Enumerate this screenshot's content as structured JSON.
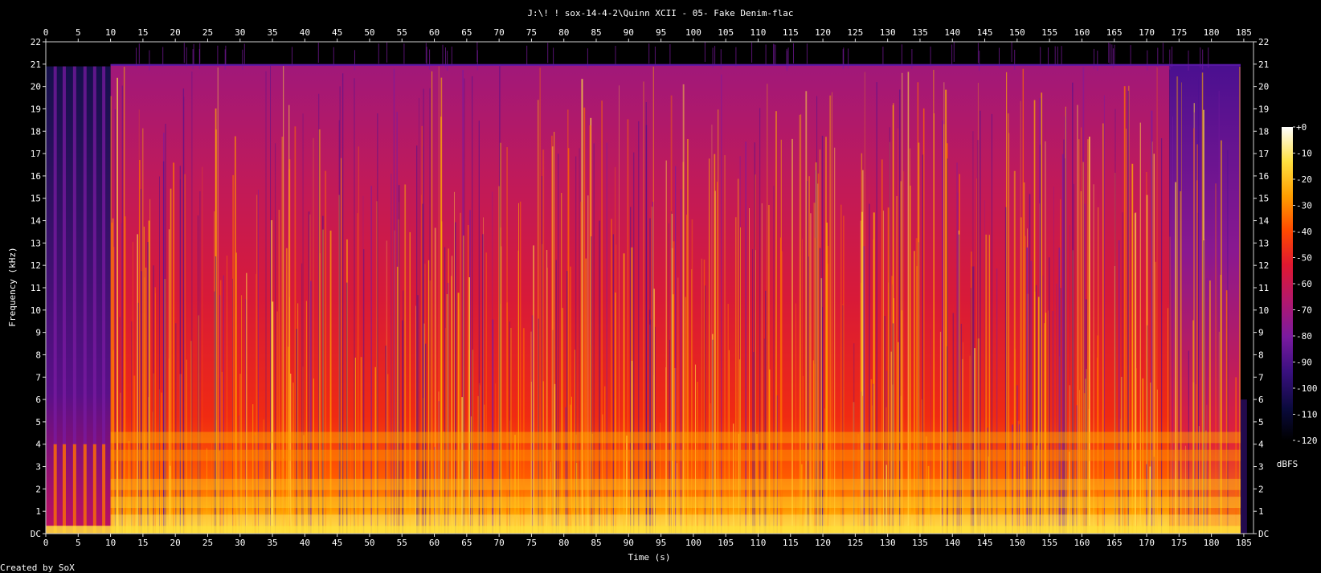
{
  "chart_data": {
    "type": "heatmap",
    "title": "J:\\! ! sox-14-4-2\\Quinn XCII - 05- Fake Denim-flac",
    "xlabel": "Time (s)",
    "ylabel": "Frequency (kHz)",
    "xlim": [
      0,
      186.5
    ],
    "ylim": [
      0,
      22
    ],
    "x_ticks": [
      0,
      5,
      10,
      15,
      20,
      25,
      30,
      35,
      40,
      45,
      50,
      55,
      60,
      65,
      70,
      75,
      80,
      85,
      90,
      95,
      100,
      105,
      110,
      115,
      120,
      125,
      130,
      135,
      140,
      145,
      150,
      155,
      160,
      165,
      170,
      175,
      180,
      185
    ],
    "y_ticks": [
      "DC",
      "1",
      "2",
      "3",
      "4",
      "5",
      "6",
      "7",
      "8",
      "9",
      "10",
      "11",
      "12",
      "13",
      "14",
      "15",
      "16",
      "17",
      "18",
      "19",
      "20",
      "21",
      "22"
    ],
    "colorbar": {
      "label": "dBFS",
      "ticks": [
        "+0",
        "-10",
        "-20",
        "-30",
        "-40",
        "-50",
        "-60",
        "-70",
        "-80",
        "-90",
        "-100",
        "-110",
        "-120"
      ],
      "range": [
        -120,
        0
      ]
    },
    "content_end_s": 184.5,
    "cutoff_khz": 21,
    "grid": false,
    "colors": [
      "#000000",
      "#0a0a3c",
      "#3a1080",
      "#7a1aa0",
      "#b01870",
      "#e01830",
      "#ff4a00",
      "#ff9e00",
      "#ffe040",
      "#ffffff"
    ]
  },
  "footer": {
    "credit": "Created by SoX"
  }
}
